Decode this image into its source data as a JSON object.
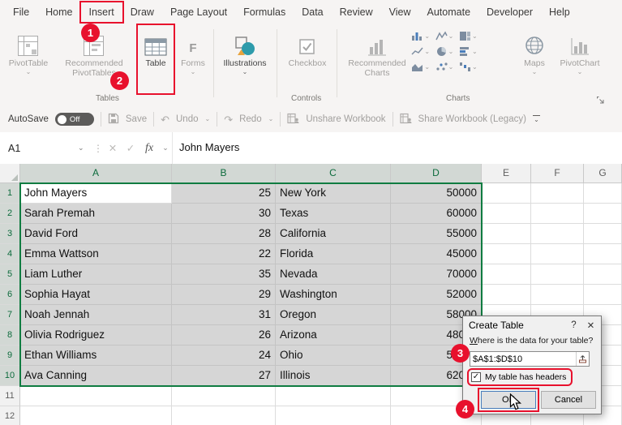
{
  "colors": {
    "annotation_red": "#e8112d",
    "excel_green": "#107c41",
    "selection_fill": "#d6d6d6"
  },
  "icons": {
    "chevron": "⌄",
    "ellipsis": "⋮",
    "cancel": "✕",
    "check": "✓",
    "undo": "↶",
    "redo": "↷",
    "forms": "F"
  },
  "tabs_bar": {
    "tabs": [
      {
        "label": "File"
      },
      {
        "label": "Home"
      },
      {
        "label": "Insert",
        "active": true,
        "annotated": true
      },
      {
        "label": "Draw"
      },
      {
        "label": "Page Layout"
      },
      {
        "label": "Formulas"
      },
      {
        "label": "Data"
      },
      {
        "label": "Review"
      },
      {
        "label": "View"
      },
      {
        "label": "Automate"
      },
      {
        "label": "Developer"
      },
      {
        "label": "Help"
      }
    ]
  },
  "ribbon": {
    "buttons": {
      "pivottable": "PivotTable",
      "recommended_pivottables": "Recommended PivotTables",
      "table": "Table",
      "forms": "Forms",
      "illustrations": "Illustrations",
      "checkbox": "Checkbox",
      "recommended_charts": "Recommended Charts",
      "maps": "Maps",
      "pivotchart": "PivotChart"
    },
    "group_labels": {
      "tables": "Tables",
      "controls": "Controls",
      "charts": "Charts"
    }
  },
  "quick_access": {
    "autosave": "AutoSave",
    "autosave_state": "Off",
    "save": "Save",
    "undo": "Undo",
    "redo": "Redo",
    "unshare": "Unshare Workbook",
    "share_legacy": "Share Workbook (Legacy)"
  },
  "formula_bar": {
    "name_box": "A1",
    "fx": "fx",
    "content": "John Mayers"
  },
  "grid": {
    "column_headers": [
      "A",
      "B",
      "C",
      "D",
      "E",
      "F",
      "G"
    ],
    "row_headers": [
      "1",
      "2",
      "3",
      "4",
      "5",
      "6",
      "7",
      "8",
      "9",
      "10",
      "11",
      "12"
    ],
    "rows": [
      [
        "John Mayers",
        "25",
        "New York",
        "50000"
      ],
      [
        "Sarah Premah",
        "30",
        "Texas",
        "60000"
      ],
      [
        "David Ford",
        "28",
        "California",
        "55000"
      ],
      [
        "Emma Wattson",
        "22",
        "Florida",
        "45000"
      ],
      [
        "Liam Luther",
        "35",
        "Nevada",
        "70000"
      ],
      [
        "Sophia Hayat",
        "29",
        "Washington",
        "52000"
      ],
      [
        "Noah Jennah",
        "31",
        "Oregon",
        "58000"
      ],
      [
        "Olivia Rodriguez",
        "26",
        "Arizona",
        "48000"
      ],
      [
        "Ethan Williams",
        "24",
        "Ohio",
        "53000"
      ],
      [
        "Ava Canning",
        "27",
        "Illinois",
        "62000"
      ]
    ],
    "selection": {
      "range": "A1:D10",
      "active_cell": "A1"
    }
  },
  "dialog": {
    "title": "Create Table",
    "help": "?",
    "close": "✕",
    "prompt_accel": "W",
    "prompt_rest": "here is the data for your table?",
    "range_value": "$A$1:$D$10",
    "headers_checkbox": "My table has headers",
    "checked": true,
    "ok": "OK",
    "cancel": "Cancel"
  },
  "annotations": {
    "step1": "1",
    "step2": "2",
    "step3": "3",
    "step4": "4"
  }
}
